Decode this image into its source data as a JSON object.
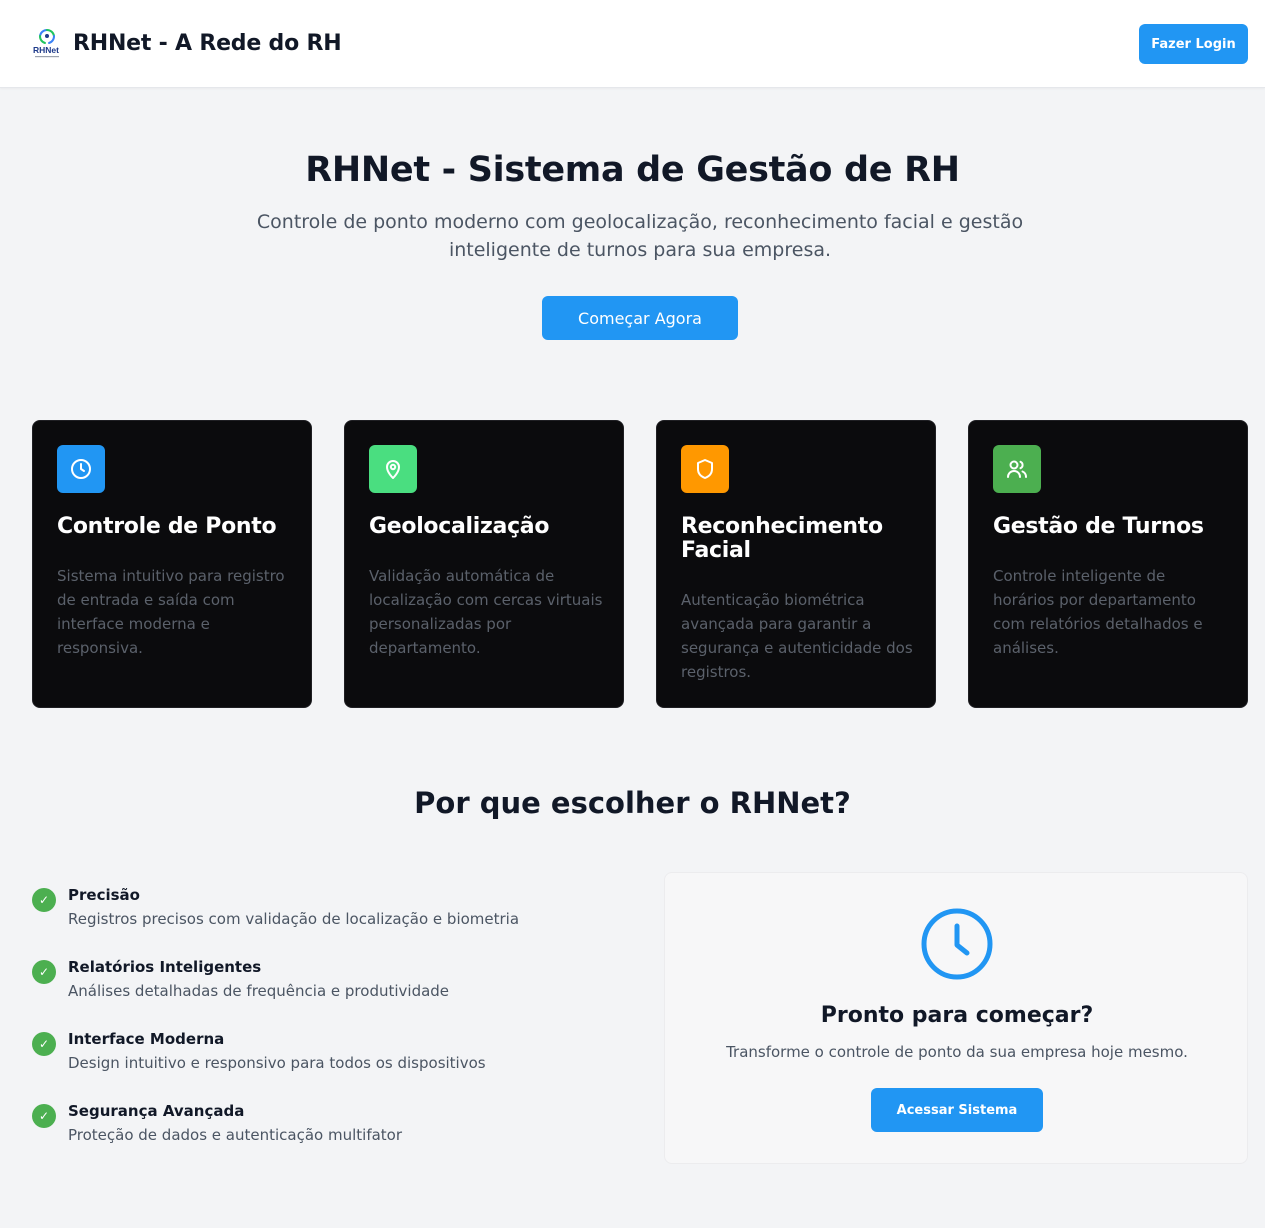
{
  "header": {
    "logo_text": "RHNet",
    "title": "RHNet - A Rede do RH",
    "login_label": "Fazer Login"
  },
  "hero": {
    "title": "RHNet - Sistema de Gestão de RH",
    "subtitle": "Controle de ponto moderno com geolocalização, reconhecimento facial e gestão inteligente de turnos para sua empresa.",
    "cta_label": "Começar Agora"
  },
  "features": [
    {
      "icon": "clock-icon",
      "color": "#2196f3",
      "title": "Controle de Ponto",
      "description": "Sistema intuitivo para registro de entrada e saída com interface moderna e responsiva."
    },
    {
      "icon": "map-pin-icon",
      "color": "#4ade80",
      "title": "Geolocalização",
      "description": "Validação automática de localização com cercas virtuais personalizadas por departamento."
    },
    {
      "icon": "shield-icon",
      "color": "#ff9800",
      "title": "Reconhecimento Facial",
      "description": "Autenticação biométrica avançada para garantir a segurança e autenticidade dos registros."
    },
    {
      "icon": "users-icon",
      "color": "#4caf50",
      "title": "Gestão de Turnos",
      "description": "Controle inteligente de horários por departamento com relatórios detalhados e análises."
    }
  ],
  "why": {
    "title": "Por que escolher o RHNet?",
    "benefits": [
      {
        "title": "Precisão",
        "description": "Registros precisos com validação de localização e biometria"
      },
      {
        "title": "Relatórios Inteligentes",
        "description": "Análises detalhadas de frequência e produtividade"
      },
      {
        "title": "Interface Moderna",
        "description": "Design intuitivo e responsivo para todos os dispositivos"
      },
      {
        "title": "Segurança Avançada",
        "description": "Proteção de dados e autenticação multifator"
      }
    ],
    "check_glyph": "✓"
  },
  "ready": {
    "title": "Pronto para começar?",
    "subtitle": "Transforme o controle de ponto da sua empresa hoje mesmo.",
    "button_label": "Acessar Sistema"
  },
  "colors": {
    "accent": "#2196f3",
    "check": "#4caf50",
    "card_bg": "#0b0b0d",
    "page_bg": "#f3f4f6"
  }
}
